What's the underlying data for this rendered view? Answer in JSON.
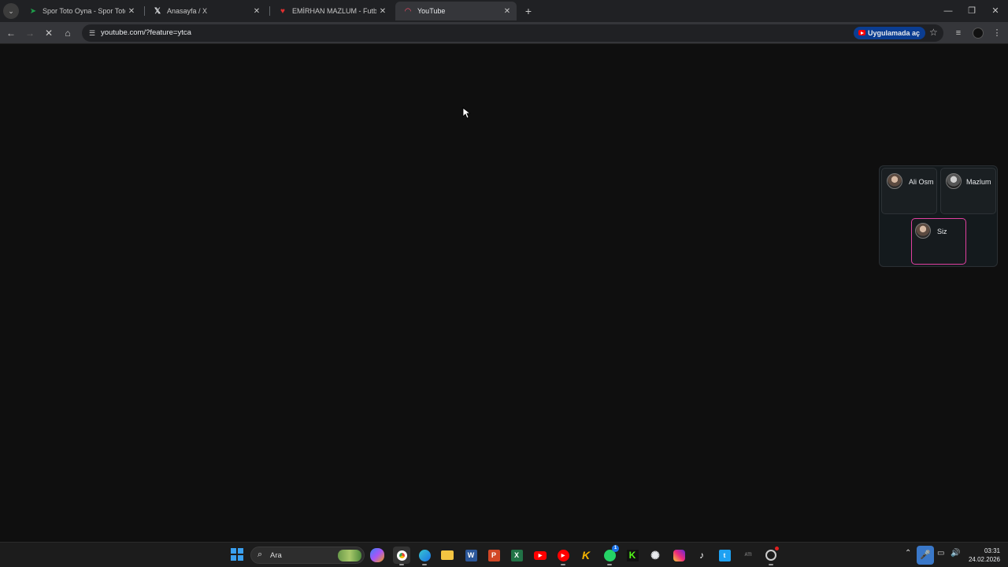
{
  "browser": {
    "tabs": [
      {
        "title": "Spor Toto Oyna - Spor Toto List",
        "favicon": "spor-toto-favicon",
        "active": false
      },
      {
        "title": "Anasayfa / X",
        "favicon": "x-favicon",
        "active": false
      },
      {
        "title": "EMİRHAN MAZLUM - Futbolcu",
        "favicon": "tff-favicon",
        "active": false
      },
      {
        "title": "YouTube",
        "favicon": "youtube-loading-favicon",
        "active": true
      }
    ],
    "url": "youtube.com/?feature=ytca",
    "open_in_app_label": "Uygulamada aç"
  },
  "call_overlay": {
    "participants": [
      {
        "name": "Ali Osm"
      },
      {
        "name": "Mazlum"
      },
      {
        "name": "Siz"
      }
    ]
  },
  "taskbar": {
    "search_placeholder": "Ara",
    "apps": [
      "copilot-icon",
      "chrome-icon",
      "edge-icon",
      "file-explorer-icon",
      "word-icon",
      "powerpoint-icon",
      "excel-icon",
      "youtube-icon",
      "youtube-music-icon",
      "kick-k-icon",
      "whatsapp-icon",
      "kick-icon",
      "chatgpt-icon",
      "instagram-icon",
      "tiktok-icon",
      "twitter-icon",
      "ati-icon",
      "steam-like-icon"
    ],
    "whatsapp_badge": "1",
    "time": "03:31",
    "date": "24.02.2026"
  },
  "colors": {
    "page_bg": "#0f0f0f",
    "chrome_bg": "#35363a",
    "accent_self_border": "#e040a0",
    "open_app_bg": "#0b3d91"
  }
}
